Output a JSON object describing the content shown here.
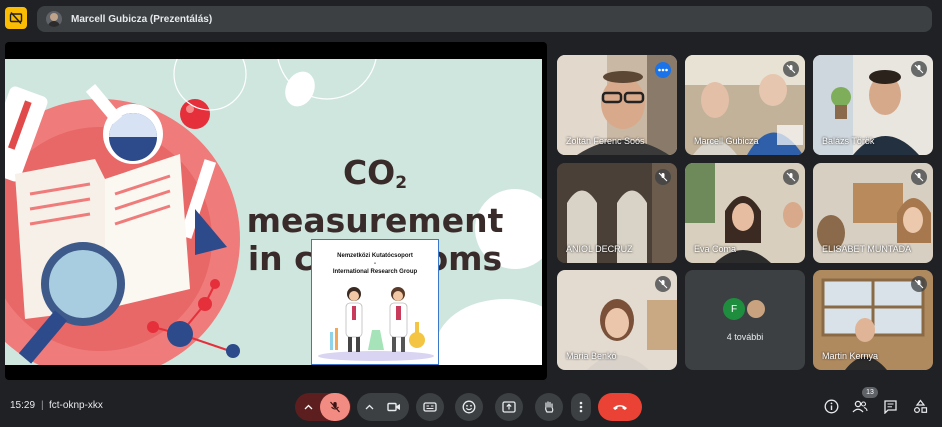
{
  "header": {
    "presenter_label": "Marcell Gubicza (Prezentálás)"
  },
  "slide": {
    "title_line1_prefix": "CO",
    "title_line1_sub": "2",
    "title_line1_suffix": " measurement",
    "title_line2": "in classrooms",
    "org_line1": "Nemzetközi Kutatócsoport",
    "org_line2": "-",
    "org_line3": "International Research Group"
  },
  "participants": [
    {
      "name": "Zoltán Ferenc Soós",
      "muted": false,
      "speaking": true
    },
    {
      "name": "Marcell Gubicza",
      "muted": true
    },
    {
      "name": "Balázs Török",
      "muted": true
    },
    {
      "name": "ANIOL DECRUZ",
      "muted": true
    },
    {
      "name": "Eva Coma",
      "muted": true
    },
    {
      "name": "ELISABET MUNTADA",
      "muted": true
    },
    {
      "name": "Maria Benkó",
      "muted": true
    },
    {
      "name": "Martin Kernya",
      "muted": true
    }
  ],
  "more_tile": {
    "label": "4 további",
    "initial": "F"
  },
  "footer": {
    "time": "15:29",
    "separator": "|",
    "meeting_code": "fct-oknp-xkx",
    "participant_count": "13"
  },
  "colors": {
    "accent": "#8ab4f8",
    "leave": "#ea4335",
    "present_badge": "#fbbc04"
  }
}
